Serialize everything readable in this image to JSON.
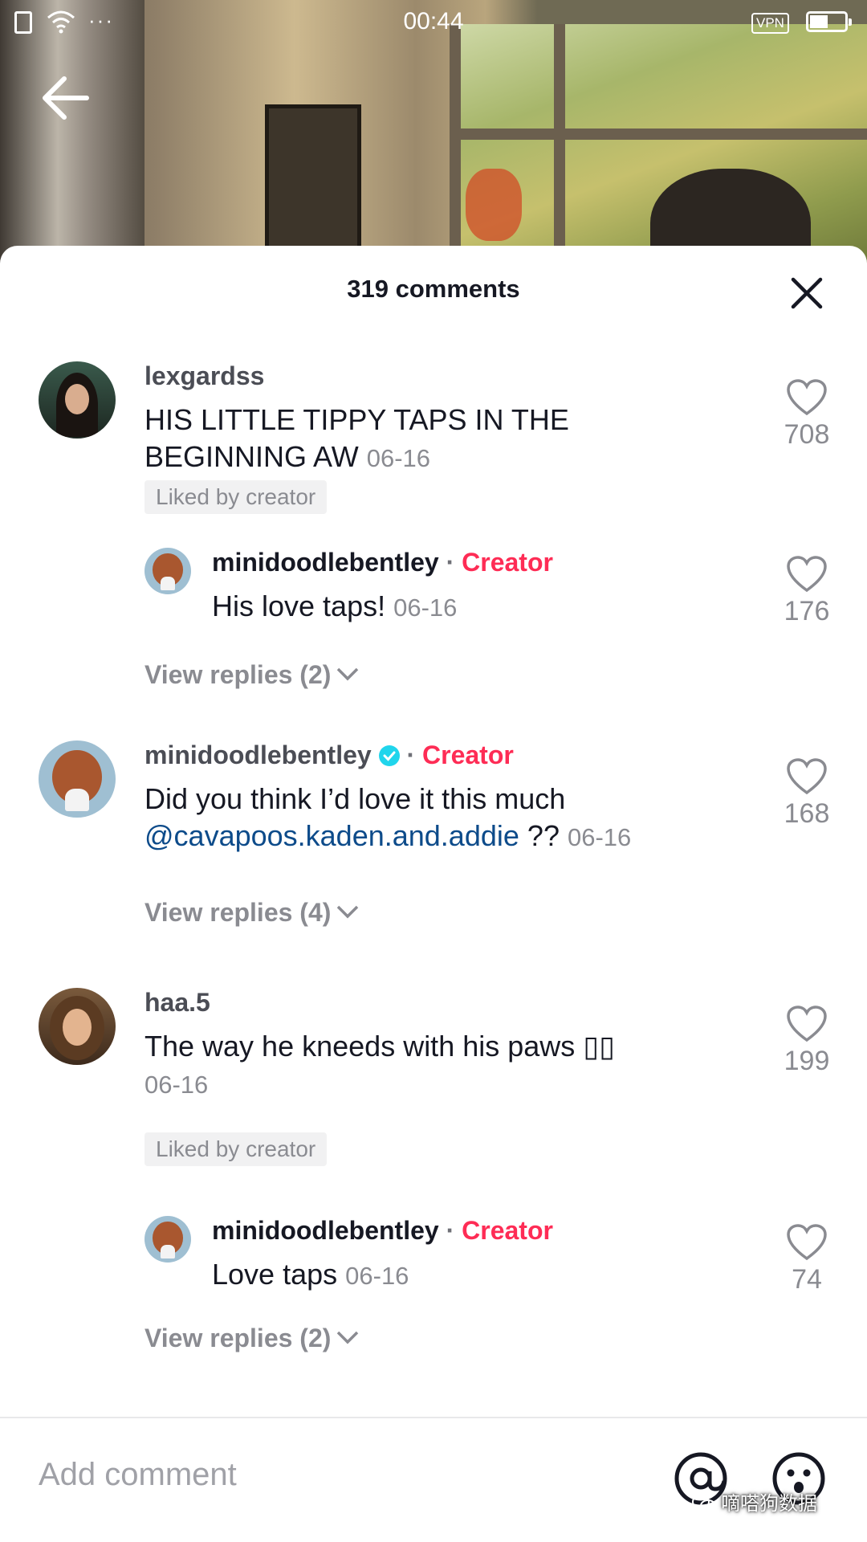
{
  "status_bar": {
    "time": "00:44",
    "vpn": "VPN",
    "dots": "···"
  },
  "sheet": {
    "title": "319 comments"
  },
  "comments": [
    {
      "username": "lexgardss",
      "text": "HIS LITTLE TIPPY TAPS IN THE BEGINNING AW",
      "date": "06-16",
      "likes": "708",
      "badge": "Liked by creator"
    },
    {
      "username": "minidoodlebentley",
      "tag": "Creator",
      "separator": "·",
      "text": "His love taps!",
      "date": "06-16",
      "likes": "176",
      "view_replies": "View replies (2)"
    },
    {
      "username": "minidoodlebentley",
      "tag": "Creator",
      "separator": "·",
      "text": "Did you think I’d love it this much",
      "mention": "@cavapoos.kaden.and.addie",
      "text_after": "??",
      "date": "06-16",
      "likes": "168",
      "view_replies": "View replies (4)"
    },
    {
      "username": "haa.5",
      "text": "The way he kneeds with his paws ▯▯",
      "date": "06-16",
      "likes": "199",
      "badge": "Liked by creator"
    },
    {
      "username": "minidoodlebentley",
      "tag": "Creator",
      "separator": "·",
      "text": "Love taps",
      "date": "06-16",
      "likes": "74",
      "view_replies": "View replies (2)"
    }
  ],
  "input": {
    "placeholder": "Add comment"
  },
  "watermark": {
    "text": "嘀嗒狗数据"
  },
  "colors": {
    "creator": "#fe2c55",
    "mention": "#0d4b8a",
    "secondary_text": "#8a8b91",
    "verified": "#20d5ec"
  },
  "icons": [
    "back-arrow-icon",
    "close-icon",
    "heart-icon",
    "verified-icon",
    "chevron-down-icon",
    "at-sign-icon",
    "emoji-icon",
    "wifi-icon",
    "battery-icon",
    "sim-icon"
  ]
}
